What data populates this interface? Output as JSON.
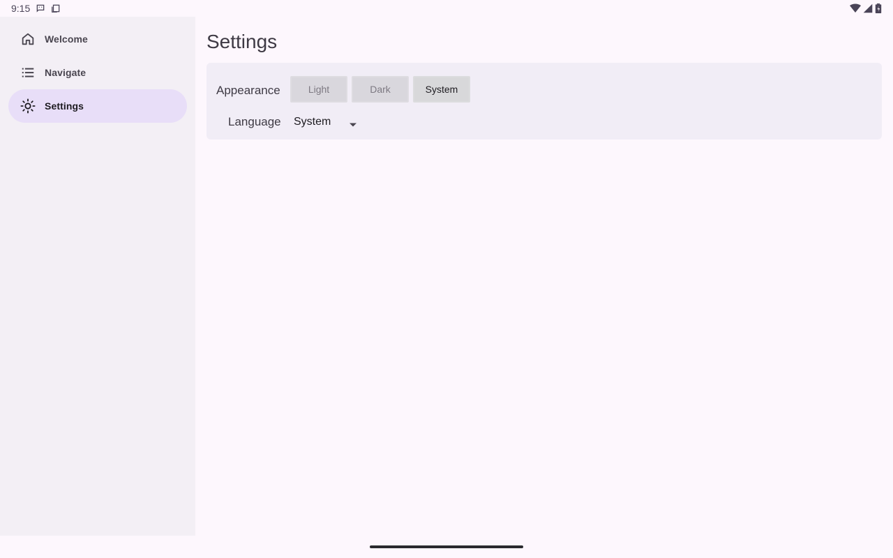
{
  "status_bar": {
    "time": "9:15",
    "icons": [
      "message-icon",
      "screenshot-icon",
      "wifi-icon",
      "signal-icon",
      "battery-icon"
    ]
  },
  "drawer": {
    "items": [
      {
        "label": "Welcome",
        "icon": "home-icon",
        "active": false
      },
      {
        "label": "Navigate",
        "icon": "list-icon",
        "active": false
      },
      {
        "label": "Settings",
        "icon": "brightness-icon",
        "active": true
      }
    ]
  },
  "main": {
    "title": "Settings",
    "appearance": {
      "label": "Appearance",
      "options": [
        "Light",
        "Dark",
        "System"
      ],
      "selected": "System"
    },
    "language": {
      "label": "Language",
      "value": "System"
    }
  },
  "colors": {
    "background": "#fdf7fd",
    "drawer": "#f3eff5",
    "active_item": "#e8def8",
    "card": "#f1edf6"
  }
}
